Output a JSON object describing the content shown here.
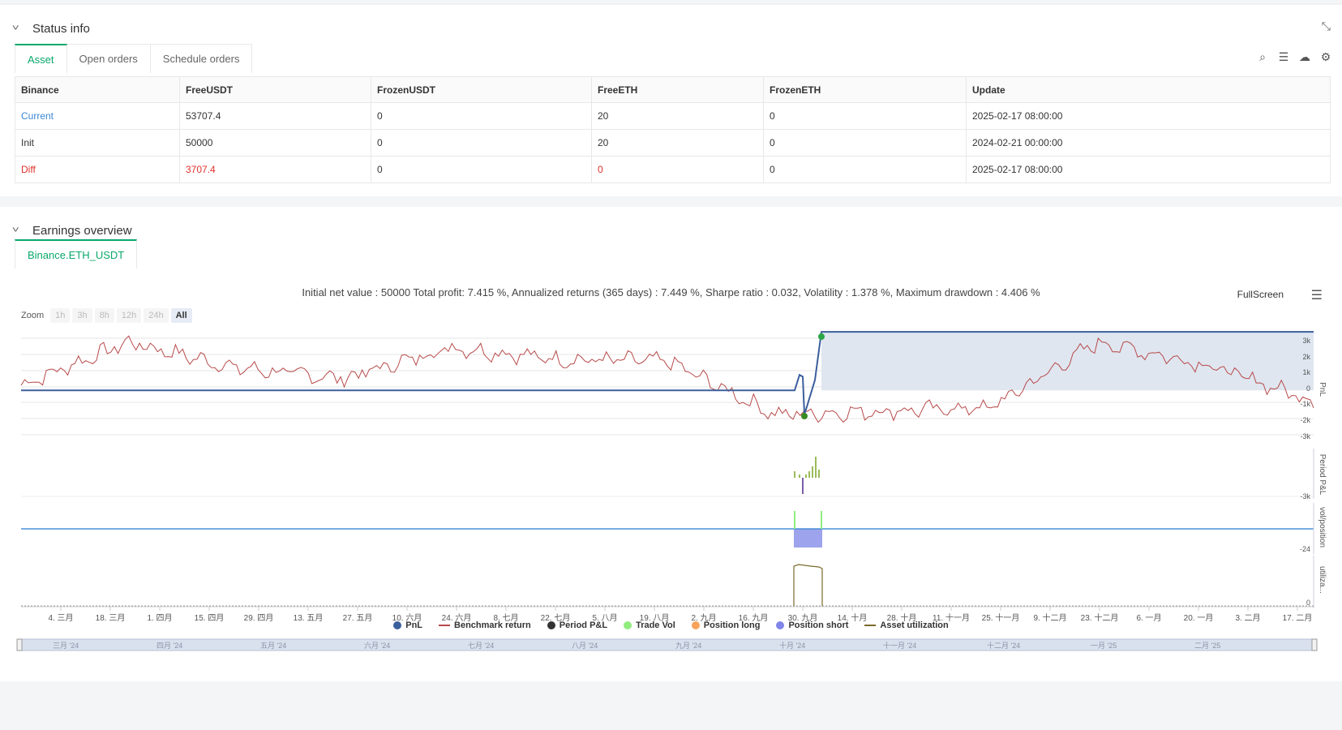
{
  "status": {
    "title": "Status info",
    "tabs": [
      "Asset",
      "Open orders",
      "Schedule orders"
    ],
    "table": {
      "headers": [
        "Binance",
        "FreeUSDT",
        "FrozenUSDT",
        "FreeETH",
        "FrozenETH",
        "Update"
      ],
      "rows": [
        [
          "Current",
          "53707.4",
          "0",
          "20",
          "0",
          "2025-02-17 08:00:00"
        ],
        [
          "Init",
          "50000",
          "0",
          "20",
          "0",
          "2024-02-21 00:00:00"
        ],
        [
          "Diff",
          "3707.4",
          "0",
          "0",
          "0",
          "2025-02-17 08:00:00"
        ]
      ]
    }
  },
  "earnings": {
    "title": "Earnings overview",
    "tab": "Binance.ETH_USDT",
    "summary": "Initial net value : 50000 Total profit: 7.415 %, Annualized returns (365 days) : 7.449 %, Sharpe ratio : 0.032, Volatility : 1.378 %, Maximum drawdown : 4.406 %",
    "fullscreen": "FullScreen",
    "zoom_label": "Zoom",
    "zoom_buttons": [
      "1h",
      "3h",
      "8h",
      "12h",
      "24h",
      "All"
    ],
    "legend": [
      "PnL",
      "Benchmark return",
      "Period P&L",
      "Trade Vol",
      "Position long",
      "Position short",
      "Asset utilization"
    ],
    "axis_titles": [
      "PnL",
      "Period P&L",
      "vol/position",
      "utiliza..."
    ],
    "x_ticks": [
      "4. 三月",
      "18. 三月",
      "1. 四月",
      "15. 四月",
      "29. 四月",
      "13. 五月",
      "27. 五月",
      "10. 六月",
      "24. 六月",
      "8. 七月",
      "22. 七月",
      "5. 八月",
      "19. 八月",
      "2. 九月",
      "16. 九月",
      "30. 九月",
      "14. 十月",
      "28. 十月",
      "11. 十一月",
      "25. 十一月",
      "9. 十二月",
      "23. 十二月",
      "6. 一月",
      "20. 一月",
      "3. 二月",
      "17. 二月"
    ],
    "y_ticks_pnl": [
      "3k",
      "2k",
      "1k",
      "0",
      "-1k",
      "-2k",
      "-3k"
    ],
    "y_tick_period": "-3k",
    "y_tick_vol": "-24",
    "y_tick_util": "0",
    "nav_labels": [
      "三月 '24",
      "四月 '24",
      "五月 '24",
      "六月 '24",
      "七月 '24",
      "八月 '24",
      "九月 '24",
      "十月 '24",
      "十一月 '24",
      "十二月 '24",
      "一月 '25",
      "二月 '25"
    ]
  },
  "colors": {
    "accent": "#0aa86c",
    "pnl": "#3b5f9c",
    "benchmark": "#b84a4a",
    "period": "#333333",
    "trade_vol": "#90ed7d",
    "position_long": "#f7a35c",
    "position_short": "#8085e9",
    "utilization": "#7a6a2a"
  },
  "chart_data": {
    "type": "line",
    "x_range": [
      "2024-02-21",
      "2025-02-17"
    ],
    "ylim": [
      -3000,
      3500
    ],
    "series": [
      {
        "name": "PnL",
        "values_by_month": [
          0,
          0,
          0,
          0,
          0,
          0,
          0,
          0,
          3400,
          3400,
          3400,
          3400,
          3400
        ]
      },
      {
        "name": "Benchmark return",
        "values_by_month": [
          300,
          2800,
          1300,
          700,
          2500,
          1800,
          1700,
          -1400,
          -1200,
          -1000,
          2800,
          1500,
          -600
        ]
      }
    ]
  }
}
